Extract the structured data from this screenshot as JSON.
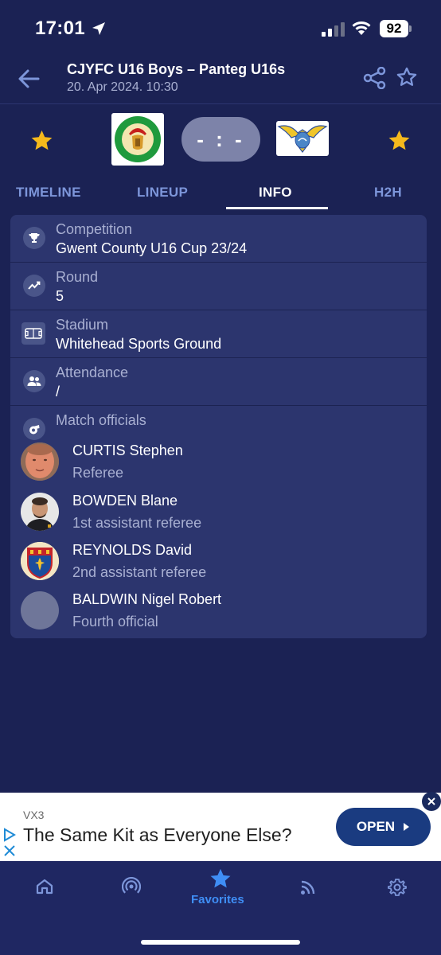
{
  "status_bar": {
    "time": "17:01",
    "battery": "92"
  },
  "header": {
    "title": "CJYFC U16 Boys – Panteg U16s",
    "datetime": "20. Apr 2024. 10:30"
  },
  "match": {
    "score": "- : -",
    "home_logo_text": "CAERLEON JUNIOR YOUTH FC",
    "away_logo_text": "PANTEG"
  },
  "tabs": [
    {
      "label": "TIMELINE",
      "active": false
    },
    {
      "label": "LINEUP",
      "active": false
    },
    {
      "label": "INFO",
      "active": true
    },
    {
      "label": "H2H",
      "active": false
    }
  ],
  "info": {
    "competition": {
      "label": "Competition",
      "value": "Gwent County U16 Cup 23/24",
      "icon": "trophy-icon"
    },
    "round": {
      "label": "Round",
      "value": "5",
      "icon": "trend-icon"
    },
    "stadium": {
      "label": "Stadium",
      "value": "Whitehead Sports Ground",
      "icon": "stadium-icon"
    },
    "attendance": {
      "label": "Attendance",
      "value": "/",
      "icon": "people-icon"
    },
    "officials_label": "Match officials"
  },
  "officials": [
    {
      "name": "CURTIS Stephen",
      "role": "Referee"
    },
    {
      "name": "BOWDEN Blane",
      "role": "1st assistant referee"
    },
    {
      "name": "REYNOLDS David",
      "role": "2nd assistant referee"
    },
    {
      "name": "BALDWIN Nigel Robert",
      "role": "Fourth official"
    }
  ],
  "ad": {
    "advertiser": "VX3",
    "headline": "The Same Kit as Everyone Else?",
    "cta": "OPEN"
  },
  "bottom_nav": {
    "items": [
      {
        "icon": "home-icon"
      },
      {
        "icon": "live-icon"
      },
      {
        "icon": "star-icon",
        "label": "Favorites",
        "active": true
      },
      {
        "icon": "feed-icon"
      },
      {
        "icon": "gear-icon"
      }
    ]
  },
  "colors": {
    "background": "#1b2254",
    "card": "#2c356e",
    "accent": "#3f8ef5",
    "star": "#f5b91c",
    "muted_text": "#a9b0d2"
  }
}
